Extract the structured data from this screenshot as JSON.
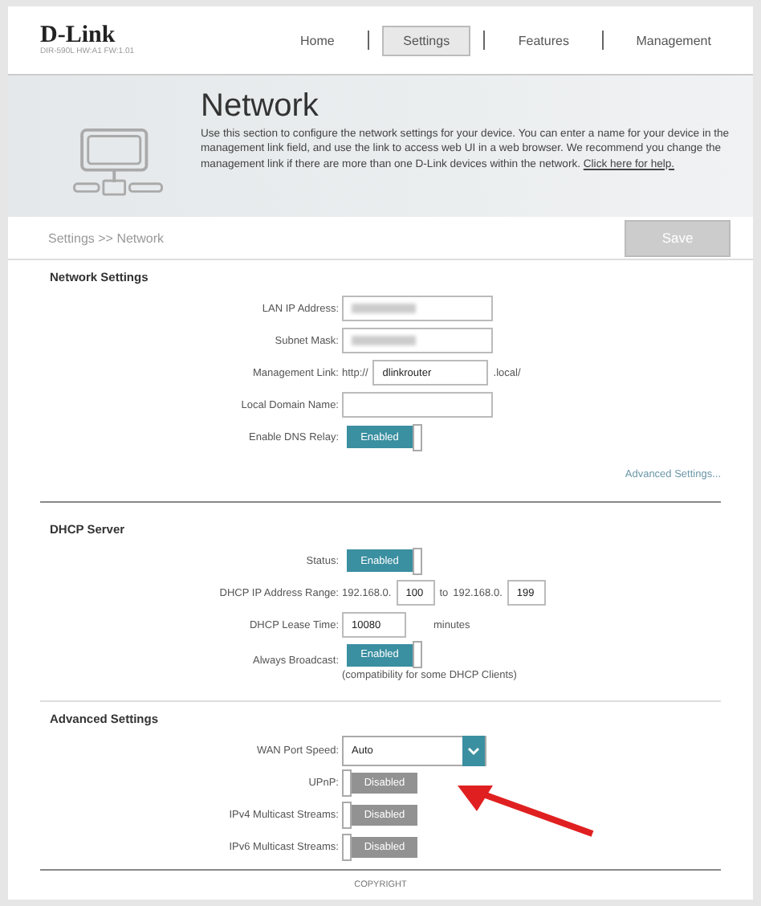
{
  "header": {
    "logo": "D-Link",
    "model": "DIR-590L   HW:A1   FW:1.01"
  },
  "nav": [
    {
      "label": "Home",
      "selected": false
    },
    {
      "label": "Settings",
      "selected": true
    },
    {
      "label": "Features",
      "selected": false
    },
    {
      "label": "Management",
      "selected": false
    }
  ],
  "banner": {
    "title": "Network",
    "description": "Use this section to configure the network settings for your device. You can enter a name for your device in the management link field, and use the link to access web UI in a web browser. We recommend you change the management link if there are more than one D-Link devices within the network.",
    "link": "Click here for help."
  },
  "breadcrumb": "Settings >> Network",
  "save_button": "Save",
  "sections": [
    {
      "title": "Network Settings",
      "link": "Advanced Settings...",
      "rows": [
        {
          "kind": "field",
          "label": "LAN IP Address:",
          "redacted": true
        },
        {
          "kind": "field",
          "label": "Subnet Mask:",
          "redacted": true
        },
        {
          "kind": "field",
          "label": "Management Link:",
          "prefix": "http://",
          "value": "dlinkrouter",
          "suffix": ".local/"
        },
        {
          "kind": "field",
          "label": "Local Domain Name:"
        },
        {
          "kind": "toggle",
          "label": "Enable DNS Relay:",
          "on": true,
          "text": "Enabled"
        }
      ]
    },
    {
      "title": "DHCP Server",
      "rows": [
        {
          "kind": "toggle",
          "label": "Status:",
          "on": true,
          "text": "Enabled"
        },
        {
          "kind": "range",
          "label": "DHCP IP Address Range:",
          "prefix": "192.168.0.",
          "from": "100",
          "mid": "to",
          "prefix2": "192.168.0.",
          "to": "199"
        },
        {
          "kind": "number",
          "label": "DHCP Lease Time:",
          "value": "10080",
          "suffix": "minutes"
        },
        {
          "kind": "toggle",
          "label": "Always Broadcast:",
          "on": true,
          "text": "Enabled",
          "note": "(compatibility for some DHCP Clients)"
        }
      ]
    },
    {
      "title": "Advanced Settings",
      "arrow": true,
      "rows": [
        {
          "kind": "select",
          "label": "WAN Port Speed:",
          "value": "Auto"
        },
        {
          "kind": "toggle",
          "label": "UPnP:",
          "on": false,
          "text": "Disabled"
        },
        {
          "kind": "toggle",
          "label": "IPv4 Multicast Streams:",
          "on": false,
          "text": "Disabled"
        },
        {
          "kind": "toggle",
          "label": "IPv6 Multicast Streams:",
          "on": false,
          "text": "Disabled"
        }
      ]
    }
  ],
  "footer": "COPYRIGHT"
}
